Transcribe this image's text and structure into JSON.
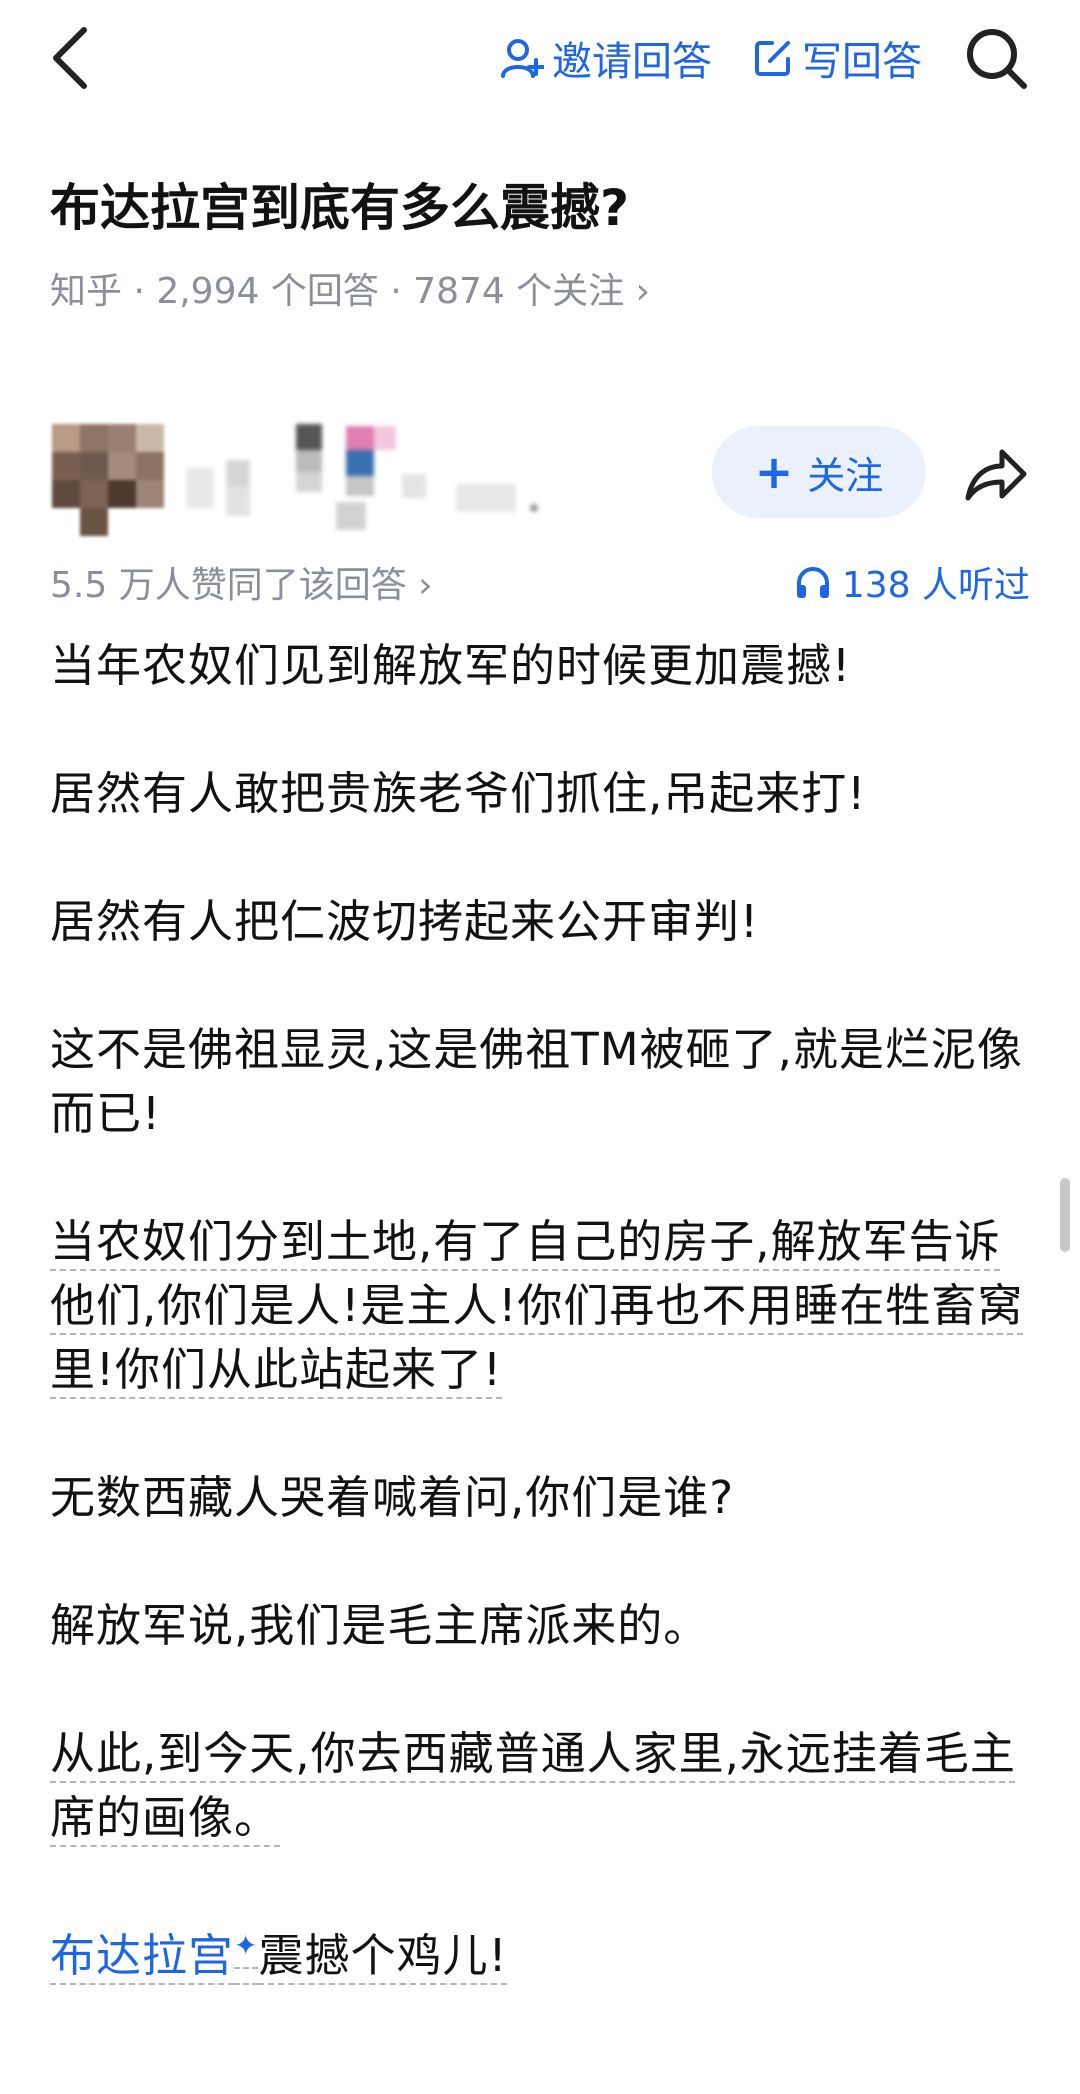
{
  "topbar": {
    "invite_label": "邀请回答",
    "write_label": "写回答"
  },
  "question": {
    "title": "布达拉宫到底有多么震撼?",
    "meta": "知乎 · 2,994 个回答 · 7874 个关注 ›"
  },
  "author": {
    "follow_label": "关注",
    "follow_plus": "+"
  },
  "stats": {
    "upvote_text": "5.5 万人赞同了该回答 ›",
    "listen_text": "138 人听过"
  },
  "answer": {
    "p1": "当年农奴们见到解放军的时候更加震撼!",
    "p2": "居然有人敢把贵族老爷们抓住,吊起来打!",
    "p3": "居然有人把仁波切拷起来公开审判!",
    "p4": "这不是佛祖显灵,这是佛祖TM被砸了,就是烂泥像而已!",
    "p5": "当农奴们分到土地,有了自己的房子,解放军告诉他们,你们是人!是主人!你们再也不用睡在牲畜窝里!你们从此站起来了!",
    "p6": "无数西藏人哭着喊着问,你们是谁?",
    "p7": "解放军说,我们是毛主席派来的。",
    "p8": "从此,到今天,你去西藏普通人家里,永远挂着毛主席的画像。",
    "p9_link": "布达拉宫",
    "p9_star": "✦",
    "p9_rest": "震撼个鸡儿!"
  },
  "colors": {
    "accent": "#1f66e5",
    "follow_bg": "#eaf1fd",
    "meta_gray": "#8a8f99",
    "text": "#121212"
  },
  "icons": [
    "back-arrow-icon",
    "invite-user-icon",
    "edit-icon",
    "search-icon",
    "share-icon",
    "headphones-icon"
  ]
}
